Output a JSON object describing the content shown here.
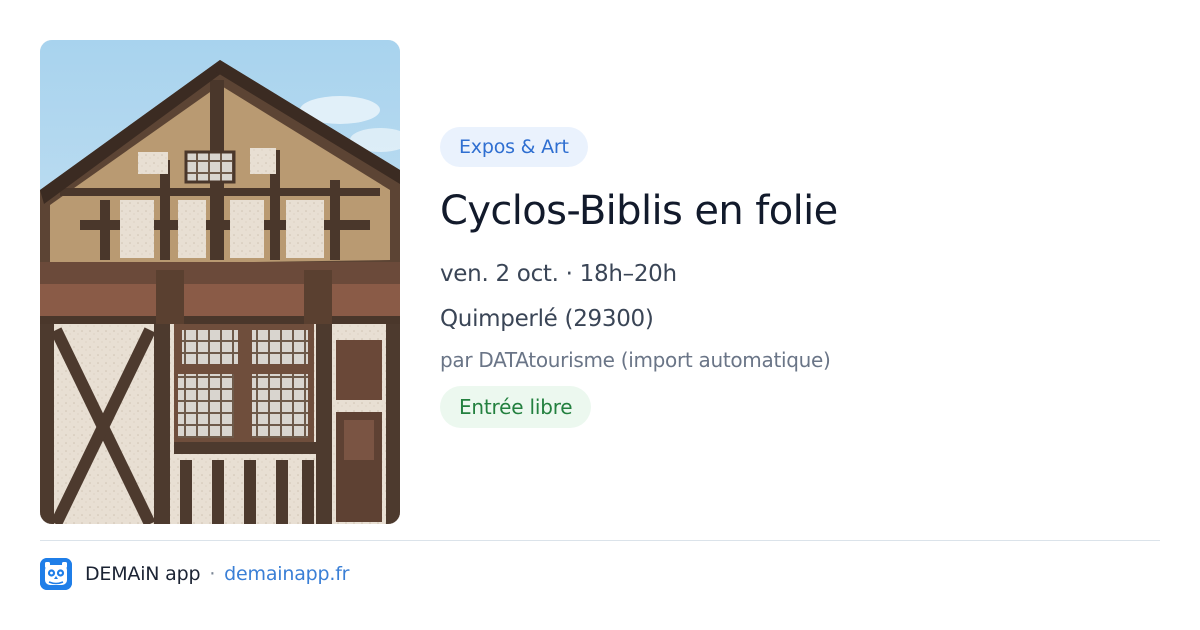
{
  "event": {
    "category": "Expos & Art",
    "title": "Cyclos-Biblis en folie",
    "datetime": "ven. 2 oct. · 18h–20h",
    "location": "Quimperlé (29300)",
    "source": "par DATAtourisme (import automatique)",
    "price": "Entrée libre"
  },
  "footer": {
    "app_name": "DEMAiN app",
    "separator": "·",
    "url": "demainapp.fr"
  },
  "colors": {
    "category_bg": "#eaf2fd",
    "category_text": "#2f6fd1",
    "price_bg": "#ecf8ef",
    "price_text": "#23803f",
    "link": "#3a7fd6",
    "logo": "#1f7ee8"
  },
  "icons": {
    "app_logo": "owl-icon"
  }
}
